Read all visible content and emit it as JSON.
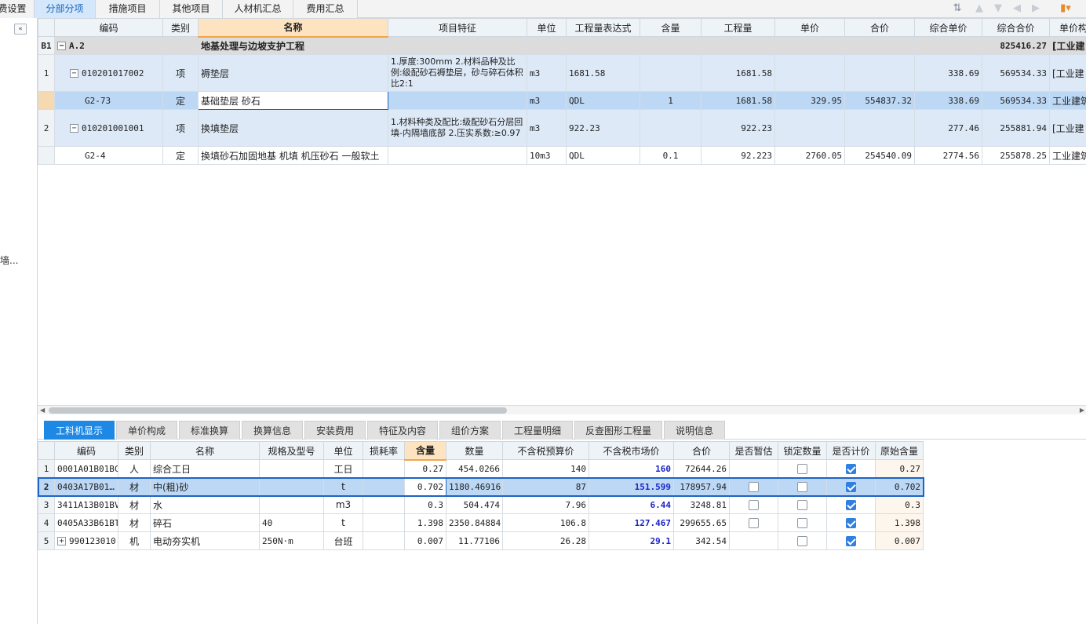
{
  "top_tabs": [
    "费设置",
    "分部分项",
    "措施项目",
    "其他项目",
    "人材机汇总",
    "费用汇总"
  ],
  "active_top_tab": "分部分项",
  "left_panel": {
    "collapse": "«",
    "side_text": "墙..."
  },
  "upper_table": {
    "headers": [
      "编码",
      "类别",
      "名称",
      "项目特征",
      "单位",
      "工程量表达式",
      "含量",
      "工程量",
      "单价",
      "合价",
      "综合单价",
      "综合合价",
      "单价构"
    ],
    "selected_header": "名称",
    "rows": [
      {
        "idx": "B1",
        "code": "A.2",
        "type": "",
        "name": "地基处理与边坡支护工程",
        "feature": "",
        "unit": "",
        "expr": "",
        "qty_ratio": "",
        "qty": "",
        "price": "",
        "total": "",
        "comp_price": "",
        "comp_total": "825416.27",
        "price_comp": "[工业建"
      },
      {
        "idx": "1",
        "code": "010201017002",
        "type": "项",
        "name": "褥垫层",
        "feature": "1.厚度:300mm\n2.材料品种及比例:级配砂石褥垫层，砂与碎石体积比2:1",
        "unit": "m3",
        "expr": "1681.58",
        "qty_ratio": "",
        "qty": "1681.58",
        "price": "",
        "total": "",
        "comp_price": "338.69",
        "comp_total": "569534.33",
        "price_comp": "[工业建"
      },
      {
        "idx": "",
        "code": "G2-73",
        "type": "定",
        "name": "基础垫层 砂石",
        "feature": "",
        "unit": "m3",
        "expr": "QDL",
        "qty_ratio": "1",
        "qty": "1681.58",
        "price": "329.95",
        "total": "554837.32",
        "comp_price": "338.69",
        "comp_total": "569534.33",
        "price_comp": "工业建筑"
      },
      {
        "idx": "2",
        "code": "010201001001",
        "type": "项",
        "name": "换填垫层",
        "feature": "1.材料种类及配比:级配砂石分层回填-内隔墙底部\n2.压实系数:≥0.97",
        "unit": "m3",
        "expr": "922.23",
        "qty_ratio": "",
        "qty": "922.23",
        "price": "",
        "total": "",
        "comp_price": "277.46",
        "comp_total": "255881.94",
        "price_comp": "[工业建"
      },
      {
        "idx": "",
        "code": "G2-4",
        "type": "定",
        "name": "换填砂石加固地基 机填 机压砂石 一般软土",
        "feature": "",
        "unit": "10m3",
        "expr": "QDL",
        "qty_ratio": "0.1",
        "qty": "92.223",
        "price": "2760.05",
        "total": "254540.09",
        "comp_price": "2774.56",
        "comp_total": "255878.25",
        "price_comp": "工业建筑"
      }
    ]
  },
  "bottom_tabs": [
    "工料机显示",
    "单价构成",
    "标准换算",
    "换算信息",
    "安装费用",
    "特征及内容",
    "组价方案",
    "工程量明细",
    "反查图形工程量",
    "说明信息"
  ],
  "active_bottom_tab": "工料机显示",
  "lower_table": {
    "headers": [
      "编码",
      "类别",
      "名称",
      "规格及型号",
      "单位",
      "损耗率",
      "含量",
      "数量",
      "不含税预算价",
      "不含税市场价",
      "合价",
      "是否暂估",
      "锁定数量",
      "是否计价",
      "原始含量"
    ],
    "selected_header": "含量",
    "rows": [
      {
        "idx": "1",
        "code": "0001A01B01BC",
        "type": "人",
        "name": "综合工日",
        "spec": "",
        "unit": "工日",
        "loss": "",
        "ratio": "0.27",
        "qty": "454.0266",
        "budget": "140",
        "market": "160",
        "total": "72644.26",
        "est": null,
        "lock": false,
        "price": true,
        "orig": "0.27"
      },
      {
        "idx": "2",
        "code": "0403A17B01…",
        "type": "材",
        "name": "中(粗)砂",
        "spec": "",
        "unit": "t",
        "loss": "",
        "ratio": "0.702",
        "qty": "1180.46916",
        "budget": "87",
        "market": "151.599",
        "total": "178957.94",
        "est": false,
        "lock": false,
        "price": true,
        "orig": "0.702"
      },
      {
        "idx": "3",
        "code": "3411A13B01BV",
        "type": "材",
        "name": "水",
        "spec": "",
        "unit": "m3",
        "loss": "",
        "ratio": "0.3",
        "qty": "504.474",
        "budget": "7.96",
        "market": "6.44",
        "total": "3248.81",
        "est": false,
        "lock": false,
        "price": true,
        "orig": "0.3"
      },
      {
        "idx": "4",
        "code": "0405A33B61BT",
        "type": "材",
        "name": "碎石",
        "spec": "40",
        "unit": "t",
        "loss": "",
        "ratio": "1.398",
        "qty": "2350.84884",
        "budget": "106.8",
        "market": "127.467",
        "total": "299655.65",
        "est": false,
        "lock": false,
        "price": true,
        "orig": "1.398"
      },
      {
        "idx": "5",
        "code": "990123010",
        "type": "机",
        "name": "电动夯实机",
        "spec": "250N·m",
        "unit": "台班",
        "loss": "",
        "ratio": "0.007",
        "qty": "11.77106",
        "budget": "26.28",
        "market": "29.1",
        "total": "342.54",
        "est": null,
        "lock": false,
        "price": true,
        "orig": "0.007"
      }
    ]
  },
  "colors": {
    "accent": "#1e88e5",
    "selected_row": "#bcd8f5",
    "item_row": "#dde9f7",
    "market_price": "#1a25c8"
  }
}
